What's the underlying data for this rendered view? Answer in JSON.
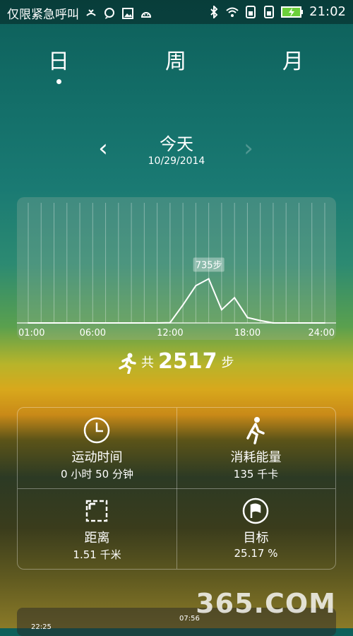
{
  "status_bar": {
    "carrier": "仅限紧急呼叫",
    "time": "21:02"
  },
  "tabs": [
    {
      "label": "日"
    },
    {
      "label": "周"
    },
    {
      "label": "月"
    }
  ],
  "date_nav": {
    "title": "今天",
    "date": "10/29/2014"
  },
  "chart_data": {
    "type": "line",
    "x_ticks": [
      "01:00",
      "06:00",
      "12:00",
      "18:00",
      "24:00"
    ],
    "x": [
      1,
      2,
      3,
      4,
      5,
      6,
      7,
      8,
      9,
      10,
      11,
      12,
      13,
      14,
      15,
      16,
      17,
      18,
      19,
      20,
      21,
      22,
      23,
      24
    ],
    "values": [
      0,
      0,
      0,
      0,
      0,
      0,
      0,
      0,
      0,
      0,
      0,
      5,
      300,
      620,
      735,
      220,
      420,
      90,
      40,
      0,
      0,
      0,
      0,
      0
    ],
    "ylim": [
      0,
      2000
    ],
    "annotation": {
      "x": 15,
      "label": "735步"
    },
    "grid": true,
    "line_color": "#ffffff"
  },
  "total": {
    "prefix": "共",
    "steps": "2517",
    "unit": "步"
  },
  "stats": {
    "time": {
      "label": "运动时间",
      "value": "0 小时 50 分钟"
    },
    "energy": {
      "label": "消耗能量",
      "value": "135 千卡"
    },
    "distance": {
      "label": "距离",
      "value": "1.51 千米"
    },
    "goal": {
      "label": "目标",
      "value": "25.17 %"
    }
  },
  "bottom": {
    "time1": "22:25",
    "time2": "07:56"
  },
  "watermark": "365.COM"
}
